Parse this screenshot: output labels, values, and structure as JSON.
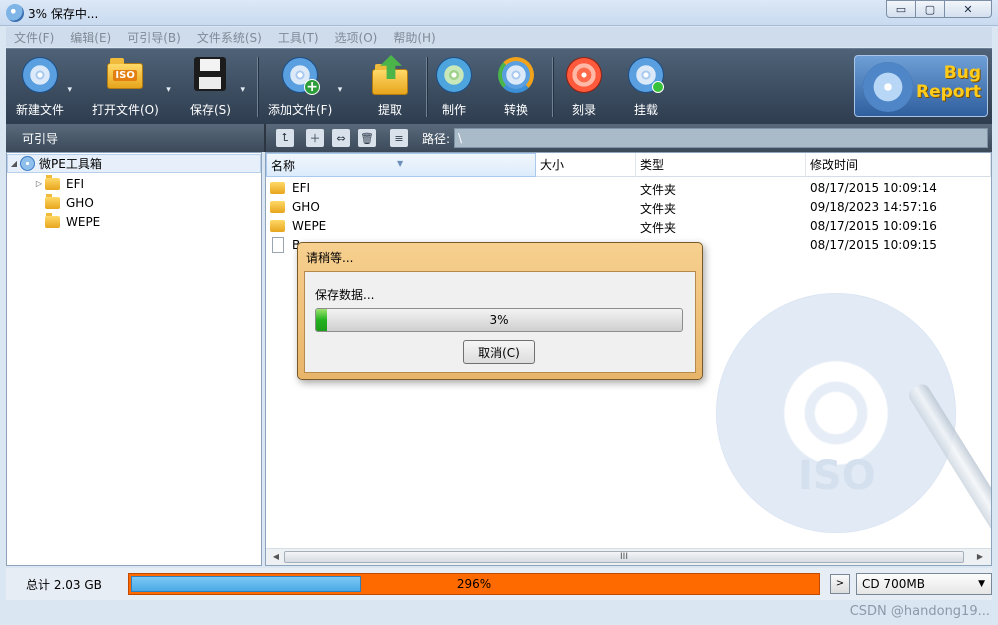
{
  "window": {
    "title": "3% 保存中...",
    "min_glyph": "▭",
    "max_glyph": "▢",
    "close_glyph": "✕"
  },
  "menu": [
    "文件(F)",
    "编辑(E)",
    "可引导(B)",
    "文件系统(S)",
    "工具(T)",
    "选项(O)",
    "帮助(H)"
  ],
  "toolbar": {
    "new": "新建文件",
    "open": "打开文件(O)",
    "save": "保存(S)",
    "add": "添加文件(F)",
    "extract": "提取",
    "make": "制作",
    "convert": "转换",
    "burn": "刻录",
    "mount": "挂载",
    "iso_badge": "ISO",
    "bug_report_line1": "Bug",
    "bug_report_line2": "Report",
    "caret": "▾"
  },
  "strip": {
    "nav_label": "可引导",
    "path_label": "路径:",
    "path_value": "\\"
  },
  "tree": {
    "root": "微PE工具箱",
    "items": [
      "EFI",
      "GHO",
      "WEPE"
    ]
  },
  "filelist": {
    "columns": [
      "名称",
      "大小",
      "类型",
      "修改时间"
    ],
    "rows": [
      {
        "name": "EFI",
        "size": "",
        "type": "文件夹",
        "modified": "08/17/2015 10:09:14"
      },
      {
        "name": "GHO",
        "size": "",
        "type": "文件夹",
        "modified": "09/18/2023 14:57:16"
      },
      {
        "name": "WEPE",
        "size": "",
        "type": "文件夹",
        "modified": "08/17/2015 10:09:16"
      },
      {
        "name": "B",
        "size": "",
        "type": "",
        "modified": "08/17/2015 10:09:15"
      }
    ],
    "watermark": "ISO",
    "scroll_grip": "III"
  },
  "dialog": {
    "title": "请稍等...",
    "message": "保存数据...",
    "progress_percent": 3,
    "progress_label": "3%",
    "cancel": "取消(C)"
  },
  "status": {
    "total": "总计 2.03 GB",
    "capacity_label": "296%",
    "media": "CD 700MB",
    "next_glyph": ">",
    "credit": "CSDN @handong19..."
  }
}
